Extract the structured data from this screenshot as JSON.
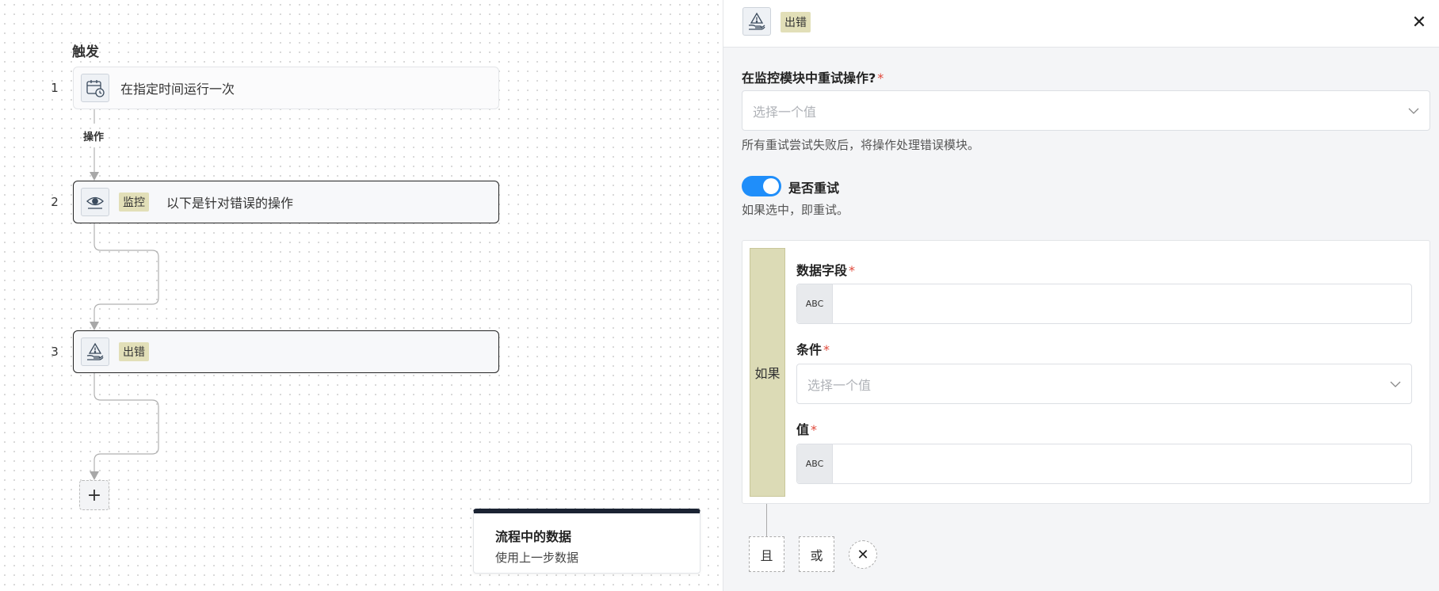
{
  "canvas": {
    "trigger_label": "触发",
    "connector_label": "操作",
    "steps": [
      {
        "num": "1",
        "text": "在指定时间运行一次",
        "icon": "calendar-clock-icon"
      },
      {
        "num": "2",
        "tag": "监控",
        "text": "以下是针对错误的操作",
        "icon": "eye-icon"
      },
      {
        "num": "3",
        "tag": "出错",
        "icon": "warning-hand-icon"
      }
    ],
    "add_label": "+",
    "data_card": {
      "title": "流程中的数据",
      "subtitle": "使用上一步数据"
    }
  },
  "panel": {
    "header_tag": "出错",
    "close_label": "✕",
    "retry_field": {
      "label": "在监控模块中重试操作?",
      "required": "*",
      "placeholder": "选择一个值",
      "hint": "所有重试尝试失败后，将操作处理错误模块。"
    },
    "toggle": {
      "label": "是否重试",
      "hint": "如果选中，即重试。",
      "checked": true
    },
    "condition": {
      "if_label": "如果",
      "data_field_label": "数据字段",
      "condition_label": "条件",
      "condition_placeholder": "选择一个值",
      "value_label": "值",
      "required": "*",
      "type_badge": "ABC"
    },
    "logic": {
      "and_label": "且",
      "or_label": "或",
      "remove_label": "✕"
    }
  },
  "colors": {
    "accent": "#1f8efa",
    "tag_bg": "#e2dfb8",
    "required": "#e0483a",
    "card_top": "#1b2333"
  }
}
